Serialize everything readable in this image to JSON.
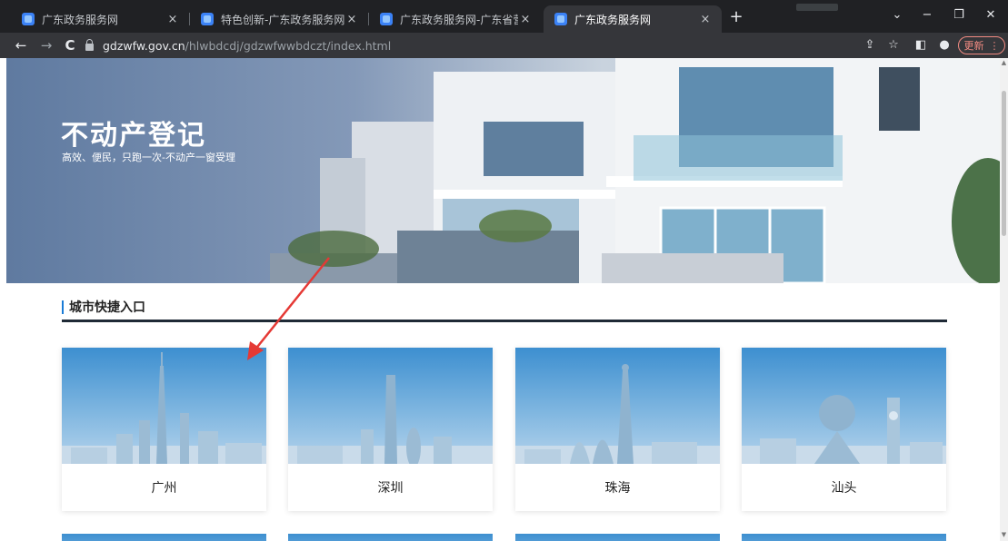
{
  "browser": {
    "tabs": [
      {
        "title": "广东政务服务网",
        "close": "×"
      },
      {
        "title": "特色创新-广东政务服务网",
        "close": "×"
      },
      {
        "title": "广东政务服务网-广东省营商环境",
        "close": "×"
      },
      {
        "title": "广东政务服务网",
        "close": "×"
      }
    ],
    "new_tab": "+",
    "window_controls": {
      "menu": "⌄",
      "minimize": "−",
      "restore": "❐",
      "close": "✕"
    },
    "nav": {
      "back": "←",
      "forward": "→",
      "reload": "C"
    },
    "url_host": "gdzwfw.gov.cn",
    "url_path": "/hlwbdcdj/gdzwfwwbdczt/index.html",
    "toolbar_icons": {
      "share": "⇪",
      "bookmark": "☆",
      "sidepanel": "◧",
      "profile": "●"
    },
    "update_label": "更新",
    "update_menu": "⋮"
  },
  "banner": {
    "title": "不动产登记",
    "subtitle": "高效、便民，只跑一次-不动产一窗受理"
  },
  "section": {
    "title": "城市快捷入口"
  },
  "cities": [
    "广州",
    "深圳",
    "珠海",
    "汕头"
  ],
  "colors": {
    "accent": "#1a7bd6",
    "annotation_arrow": "#e53935"
  }
}
